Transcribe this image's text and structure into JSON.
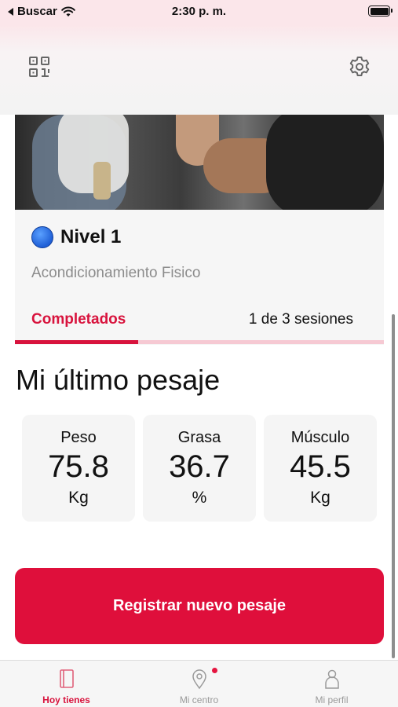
{
  "status_bar": {
    "back_label": "Buscar",
    "time": "2:30 p. m."
  },
  "level": {
    "title": "Nivel 1",
    "subtitle": "Acondicionamiento Fisico",
    "tab_label": "Completados",
    "sessions_text": "1 de 3 sesiones",
    "progress": 0.333
  },
  "weighing": {
    "title": "Mi último pesaje",
    "metrics": [
      {
        "label": "Peso",
        "value": "75.8",
        "unit": "Kg"
      },
      {
        "label": "Grasa",
        "value": "36.7",
        "unit": "%"
      },
      {
        "label": "Músculo",
        "value": "45.5",
        "unit": "Kg"
      }
    ]
  },
  "actions": {
    "register_label": "Registrar nuevo pesaje"
  },
  "tabs": [
    {
      "label": "Hoy tienes",
      "icon": "book-icon",
      "active": true
    },
    {
      "label": "Mi centro",
      "icon": "location-pin-icon",
      "active": false,
      "badge": true
    },
    {
      "label": "Mi perfil",
      "icon": "person-icon",
      "active": false
    }
  ],
  "colors": {
    "accent": "#df0f3b",
    "accent_text": "#d8133d",
    "progress_track": "#f6c9d3",
    "level_dot": "#1f5fd6"
  }
}
